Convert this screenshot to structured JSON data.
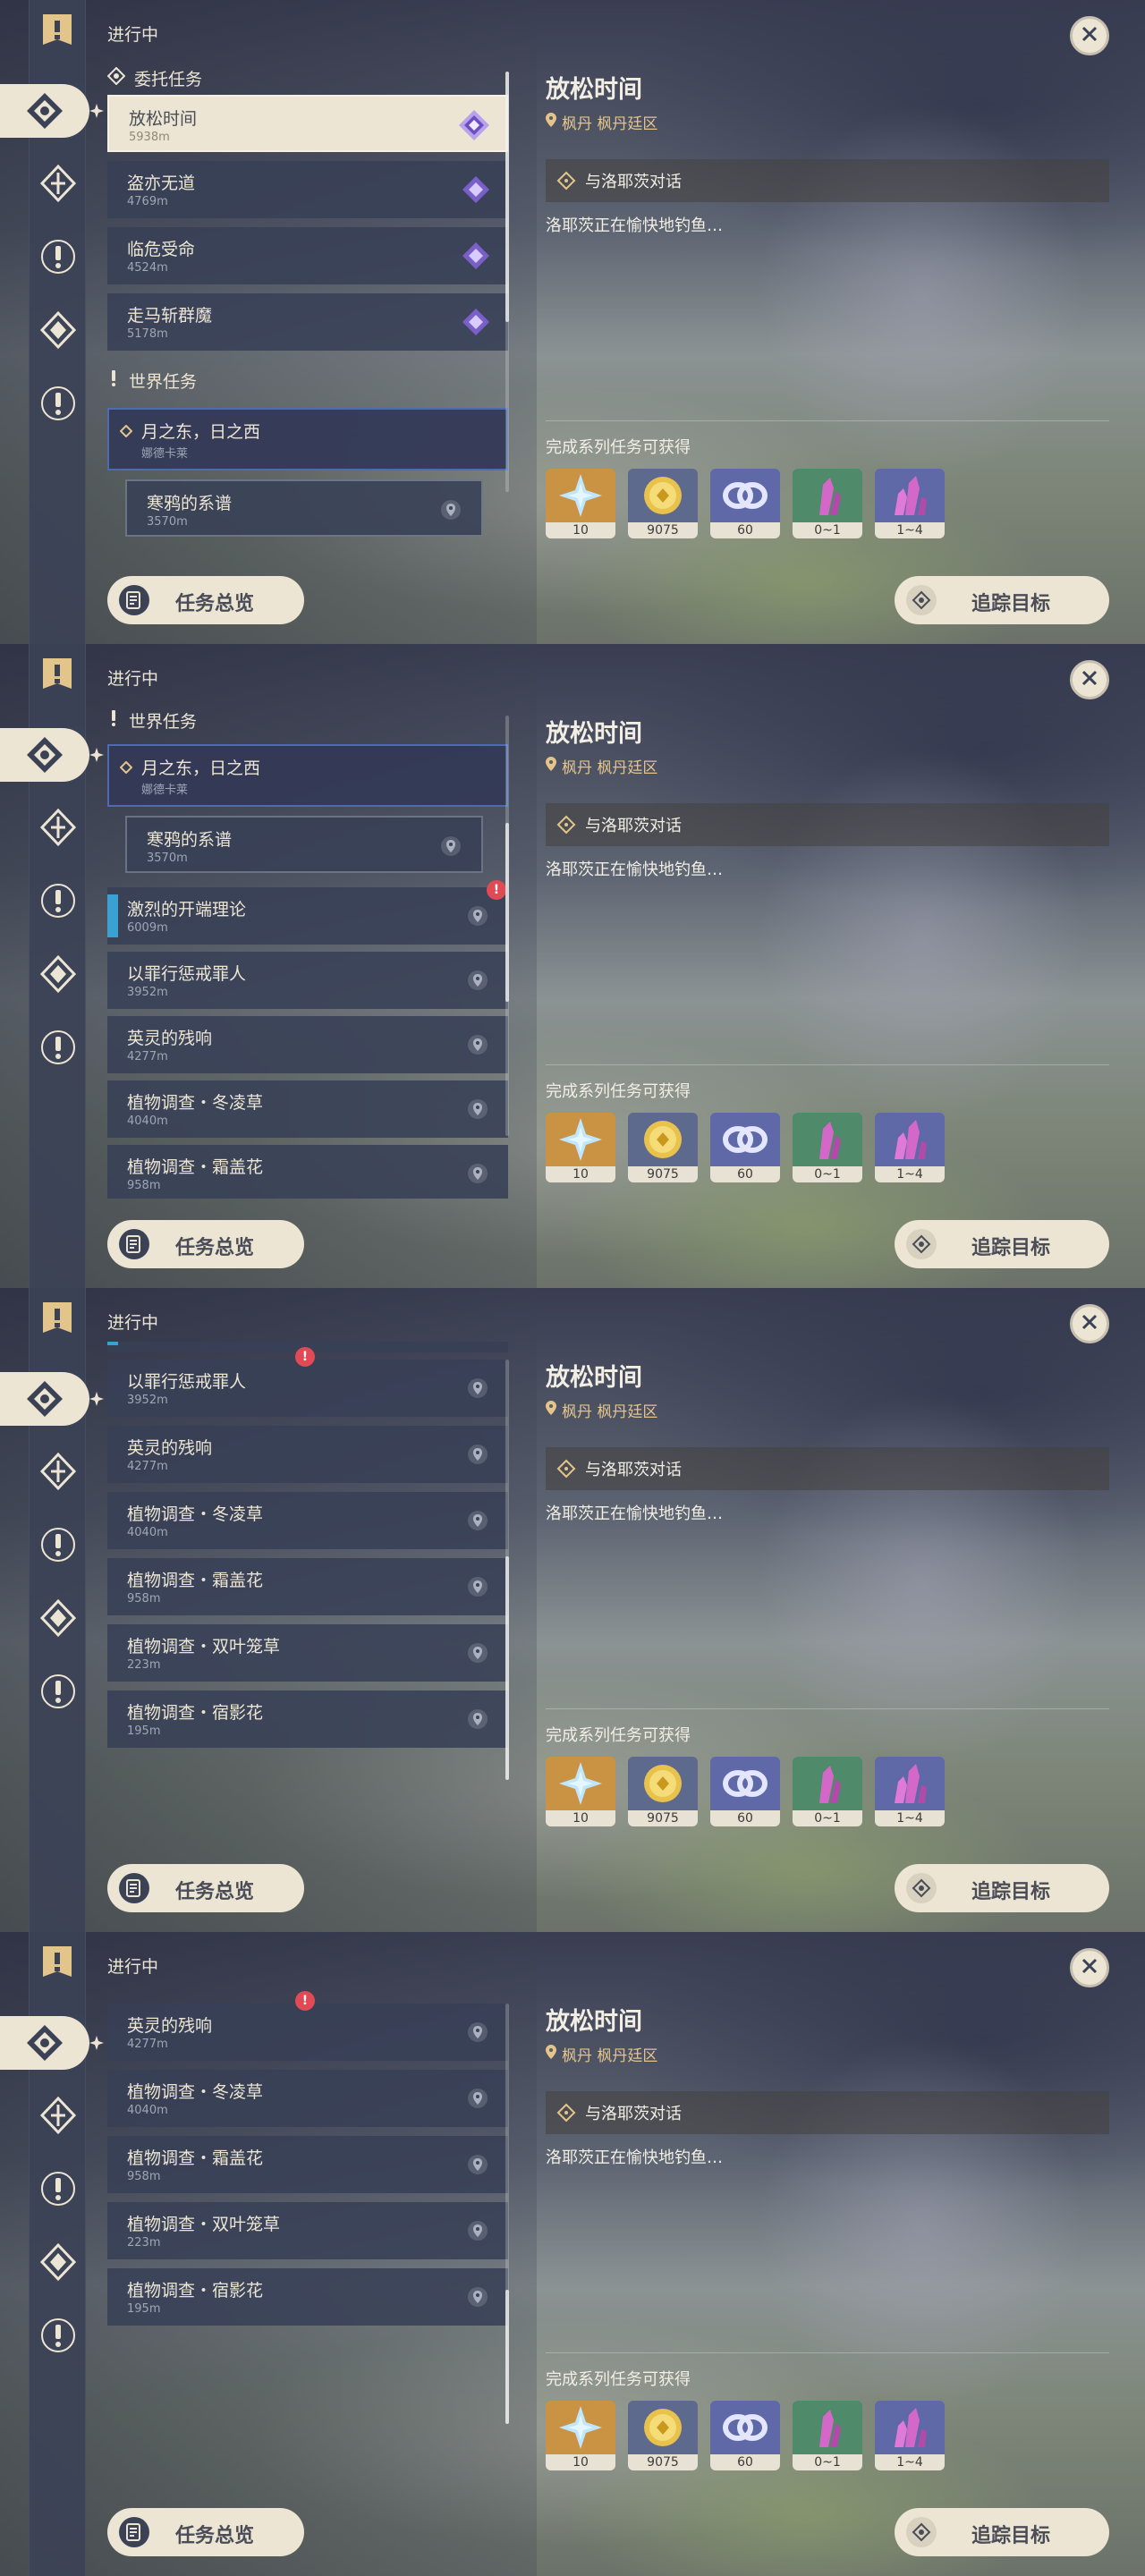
{
  "header": {
    "in_progress": "进行中"
  },
  "sections": {
    "commission": "委托任务",
    "world": "世界任务"
  },
  "quests": {
    "relax": {
      "title": "放松时间",
      "dist": "5938m"
    },
    "thief": {
      "title": "盗亦无道",
      "dist": "4769m"
    },
    "danger": {
      "title": "临危受命",
      "dist": "4524m"
    },
    "horse": {
      "title": "走马斩群魔",
      "dist": "5178m"
    },
    "moon": {
      "title": "月之东，日之西",
      "sub": "娜德卡莱"
    },
    "crow": {
      "title": "寒鸦的系谱",
      "dist": "3570m"
    },
    "theory": {
      "title": "激烈的开端理论",
      "dist": "6009m"
    },
    "crime": {
      "title": "以罪行惩戒罪人",
      "dist": "3952m"
    },
    "echo": {
      "title": "英灵的残响",
      "dist": "4277m"
    },
    "winter": {
      "title": "植物调查・冬凌草",
      "dist": "4040m"
    },
    "frost_a": {
      "title": "植物调查・霜盖花",
      "dist": "958m"
    },
    "frost_b": {
      "title": "植物调查・霜盖花",
      "dist": "958m"
    },
    "leaf": {
      "title": "植物调查・双叶笼草",
      "dist": "223m"
    },
    "shadow": {
      "title": "植物调查・宿影花",
      "dist": "195m"
    }
  },
  "detail": {
    "title": "放松时间",
    "location": "枫丹 枫丹廷区",
    "step": "与洛耶茨对话",
    "description": "洛耶茨正在愉快地钓鱼…",
    "reward_label": "完成系列任务可获得",
    "rewards": [
      {
        "name": "intertwined-fate-icon",
        "qty": "10"
      },
      {
        "name": "mora-icon",
        "qty": "9075"
      },
      {
        "name": "adventure-exp-icon",
        "qty": "60"
      },
      {
        "name": "crystal-icon",
        "qty": "0~1"
      },
      {
        "name": "crystal-cluster-icon",
        "qty": "1~4"
      }
    ]
  },
  "buttons": {
    "overview": "任务总览",
    "track": "追踪目标"
  },
  "alert": "!",
  "colors": {
    "cream": "#ece5d3",
    "card": "#384056",
    "gold": "#e3c58b",
    "purple": "#7a5fc9",
    "highlight_border": "#4e6bb1",
    "cyan_bar": "#3aa1d3",
    "alert_red": "#e04a55"
  }
}
